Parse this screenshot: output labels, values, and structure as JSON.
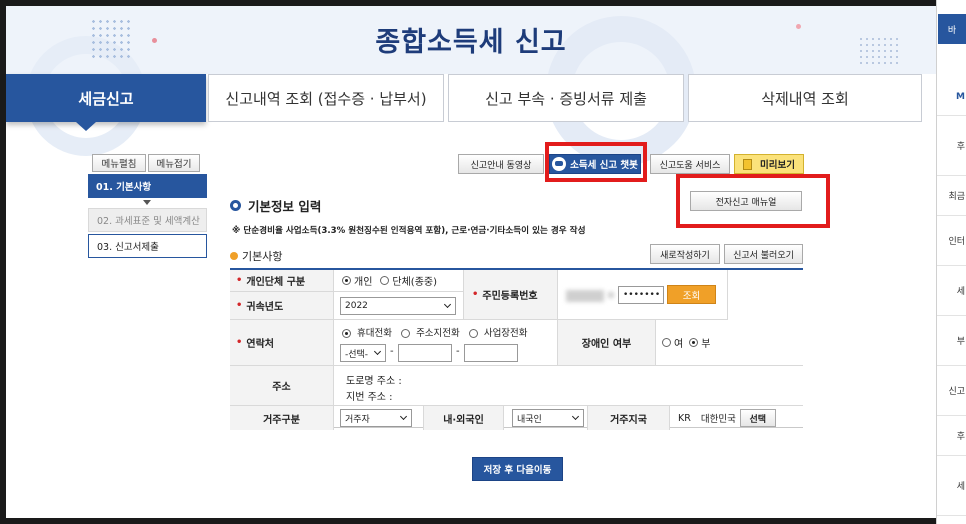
{
  "header": {
    "title": "종합소득세 신고"
  },
  "tabs": [
    {
      "label": "세금신고"
    },
    {
      "label": "신고내역 조회 (접수증 · 납부서)"
    },
    {
      "label": "신고 부속 · 증빙서류 제출"
    },
    {
      "label": "삭제내역 조회"
    }
  ],
  "sidebar": {
    "expand_label": "메뉴펼침",
    "collapse_label": "메뉴접기",
    "steps": [
      {
        "label": "01. 기본사항"
      },
      {
        "label": "02. 과세표준 및 세액계산"
      },
      {
        "label": "03. 신고서제출"
      }
    ]
  },
  "toolbar": {
    "guide_video": "신고안내 동영상",
    "chatbot": "소득세 신고 챗봇",
    "help_service": "신고도움 서비스",
    "preview": "미리보기",
    "manual": "전자신고 매뉴얼"
  },
  "section": {
    "title": "기본정보 입력",
    "note": "※ 단순경비율 사업소득(3.3% 원천징수된 인적용역 포함), 근로·연금·기타소득이 있는 경우 작성",
    "subtitle": "기본사항",
    "rewrite_button": "새로작성하기",
    "load_button": "신고서 불러오기"
  },
  "form": {
    "entity_type": {
      "label": "개인단체 구분",
      "option_personal": "개인",
      "option_group": "단체(종중)",
      "selected": "개인"
    },
    "tax_year": {
      "label": "귀속년도",
      "value": "2022"
    },
    "resident_number": {
      "label": "주민등록번호",
      "masked_value": "•••••••",
      "lookup_button": "조회"
    },
    "contact": {
      "label": "연락처",
      "option_mobile": "휴대전화",
      "option_home": "주소지전화",
      "option_business": "사업장전화",
      "selected": "휴대전화",
      "select_value": "-선택-",
      "dash": "-"
    },
    "disability": {
      "label": "장애인 여부",
      "option_yes": "여",
      "option_no": "부",
      "selected": "부"
    },
    "address": {
      "label": "주소",
      "road_label": "도로명 주소 :",
      "lot_label": "지번 주소 :"
    },
    "residence_type": {
      "label": "거주구분",
      "value": "거주자"
    },
    "nationality": {
      "label": "내·외국인",
      "value": "내국인"
    },
    "residence_country": {
      "label": "거주지국",
      "code": "KR",
      "name": "대한민국",
      "select_button": "선택"
    }
  },
  "footer": {
    "save_next": "저장 후 다음이동"
  },
  "right_panel": {
    "top": "바",
    "items": [
      "M",
      "후",
      "최금",
      "인터",
      "세",
      "부",
      "신고",
      "후",
      "세"
    ]
  },
  "colors": {
    "primary": "#27569e",
    "title": "#1e3c7a",
    "highlight_border": "#e21c1c",
    "required": "#d3272a",
    "orange": "#f0a028"
  }
}
